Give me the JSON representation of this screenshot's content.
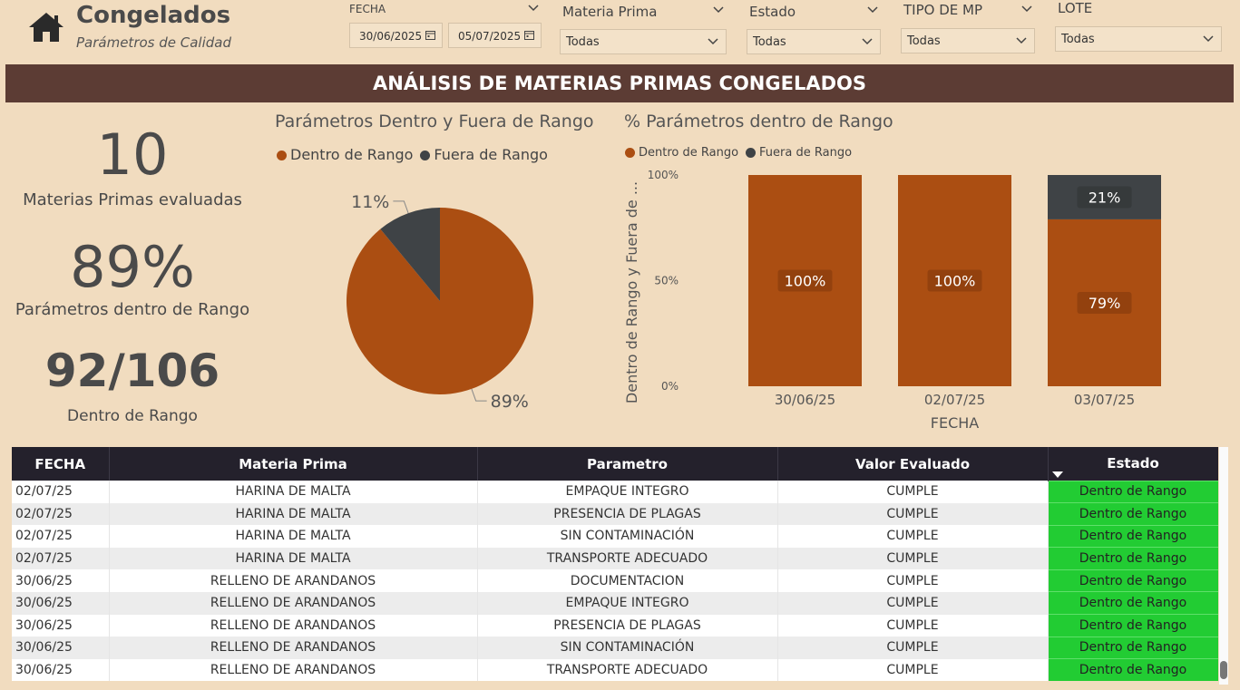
{
  "header": {
    "title": "Congelados",
    "subtitle": "Parámetros de Calidad"
  },
  "filters": {
    "fecha": {
      "label": "FECHA",
      "start": "30/06/2025",
      "end": "05/07/2025"
    },
    "materia_prima": {
      "label": "Materia Prima",
      "value": "Todas"
    },
    "estado": {
      "label": "Estado",
      "value": "Todas"
    },
    "tipo_mp": {
      "label": "TIPO DE MP",
      "value": "Todas"
    },
    "lote": {
      "label": "LOTE",
      "value": "Todas"
    }
  },
  "banner": "ANÁLISIS DE MATERIAS PRIMAS CONGELADOS",
  "kpis": [
    {
      "value": "10",
      "label": "Materias Primas evaluadas"
    },
    {
      "value": "89%",
      "label": "Parámetros dentro de Rango"
    },
    {
      "value": "92/106",
      "label": "Dentro de Rango"
    }
  ],
  "colors": {
    "dentro": "#ab4e12",
    "fuera": "#3f4346",
    "status_green": "#22cc33",
    "banner": "#5c3c34"
  },
  "chart_data": [
    {
      "type": "pie",
      "title": "Parámetros Dentro y Fuera de Rango",
      "legend": [
        "Dentro de Rango",
        "Fuera de Rango"
      ],
      "labels": [
        "Dentro de Rango",
        "Fuera de Rango"
      ],
      "values": [
        89,
        11
      ],
      "value_labels": [
        "89%",
        "11%"
      ],
      "legend_position": "top"
    },
    {
      "type": "bar",
      "stacked": true,
      "title": "% Parámetros dentro de Rango",
      "legend": [
        "Dentro de Rango",
        "Fuera de Rango"
      ],
      "categories": [
        "30/06/25",
        "02/07/25",
        "03/07/25"
      ],
      "series": [
        {
          "name": "Dentro de Rango",
          "values": [
            100,
            100,
            79
          ],
          "labels": [
            "100%",
            "100%",
            "79%"
          ]
        },
        {
          "name": "Fuera de Rango",
          "values": [
            0,
            0,
            21
          ],
          "labels": [
            "",
            "",
            "21%"
          ]
        }
      ],
      "xlabel": "FECHA",
      "ylabel": "Dentro de Rango y Fuera de ...",
      "yticks": [
        "0%",
        "50%",
        "100%"
      ],
      "ylim": [
        0,
        100
      ],
      "legend_position": "top-left"
    }
  ],
  "table": {
    "columns": [
      "FECHA",
      "Materia Prima",
      "Parametro",
      "Valor Evaluado",
      "Estado"
    ],
    "rows": [
      [
        "02/07/25",
        "HARINA DE MALTA",
        "EMPAQUE INTEGRO",
        "CUMPLE",
        "Dentro de Rango"
      ],
      [
        "02/07/25",
        "HARINA DE MALTA",
        "PRESENCIA DE PLAGAS",
        "CUMPLE",
        "Dentro de Rango"
      ],
      [
        "02/07/25",
        "HARINA DE MALTA",
        "SIN CONTAMINACIÓN",
        "CUMPLE",
        "Dentro de Rango"
      ],
      [
        "02/07/25",
        "HARINA DE MALTA",
        "TRANSPORTE ADECUADO",
        "CUMPLE",
        "Dentro de Rango"
      ],
      [
        "30/06/25",
        "RELLENO DE ARANDANOS",
        "DOCUMENTACION",
        "CUMPLE",
        "Dentro de Rango"
      ],
      [
        "30/06/25",
        "RELLENO DE ARANDANOS",
        "EMPAQUE INTEGRO",
        "CUMPLE",
        "Dentro de Rango"
      ],
      [
        "30/06/25",
        "RELLENO DE ARANDANOS",
        "PRESENCIA DE PLAGAS",
        "CUMPLE",
        "Dentro de Rango"
      ],
      [
        "30/06/25",
        "RELLENO DE ARANDANOS",
        "SIN CONTAMINACIÓN",
        "CUMPLE",
        "Dentro de Rango"
      ],
      [
        "30/06/25",
        "RELLENO DE ARANDANOS",
        "TRANSPORTE ADECUADO",
        "CUMPLE",
        "Dentro de Rango"
      ]
    ]
  }
}
